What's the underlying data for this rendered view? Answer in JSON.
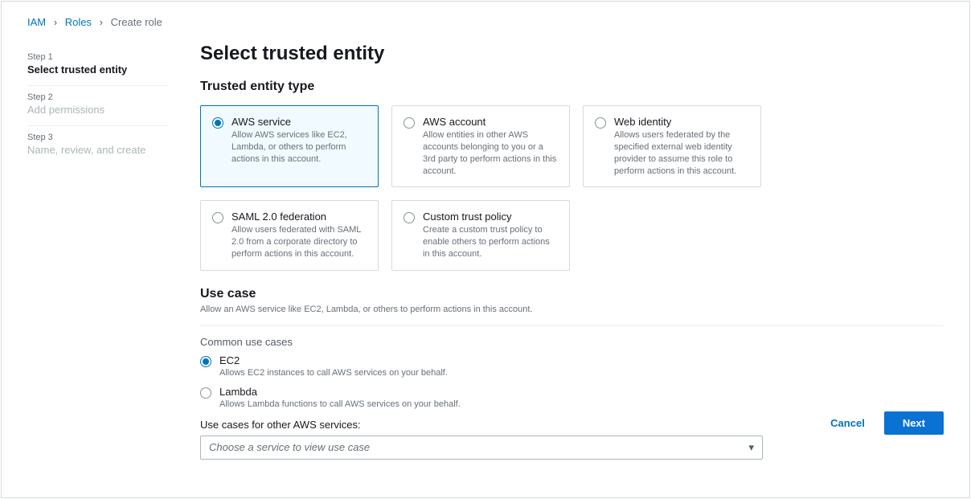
{
  "breadcrumbs": {
    "items": [
      "IAM",
      "Roles",
      "Create role"
    ]
  },
  "stepper": {
    "steps": [
      {
        "num": "Step 1",
        "title": "Select trusted entity"
      },
      {
        "num": "Step 2",
        "title": "Add permissions"
      },
      {
        "num": "Step 3",
        "title": "Name, review, and create"
      }
    ]
  },
  "page": {
    "title": "Select trusted entity",
    "trusted_section": "Trusted entity type"
  },
  "entity_cards": [
    {
      "title": "AWS service",
      "desc": "Allow AWS services like EC2, Lambda, or others to perform actions in this account.",
      "selected": true
    },
    {
      "title": "AWS account",
      "desc": "Allow entities in other AWS accounts belonging to you or a 3rd party to perform actions in this account.",
      "selected": false
    },
    {
      "title": "Web identity",
      "desc": "Allows users federated by the specified external web identity provider to assume this role to perform actions in this account.",
      "selected": false
    },
    {
      "title": "SAML 2.0 federation",
      "desc": "Allow users federated with SAML 2.0 from a corporate directory to perform actions in this account.",
      "selected": false
    },
    {
      "title": "Custom trust policy",
      "desc": "Create a custom trust policy to enable others to perform actions in this account.",
      "selected": false
    }
  ],
  "use_case": {
    "heading": "Use case",
    "sub": "Allow an AWS service like EC2, Lambda, or others to perform actions in this account.",
    "common_label": "Common use cases",
    "options": [
      {
        "title": "EC2",
        "desc": "Allows EC2 instances to call AWS services on your behalf.",
        "selected": true
      },
      {
        "title": "Lambda",
        "desc": "Allows Lambda functions to call AWS services on your behalf.",
        "selected": false
      }
    ],
    "other_label": "Use cases for other AWS services:",
    "select_placeholder": "Choose a service to view use case"
  },
  "footer": {
    "cancel": "Cancel",
    "next": "Next"
  }
}
